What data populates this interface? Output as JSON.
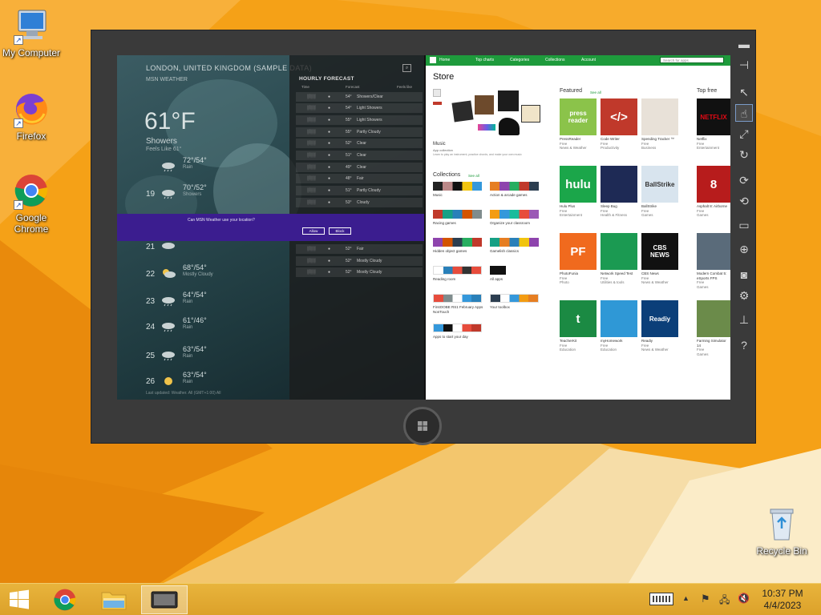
{
  "desktop": {
    "icons": [
      {
        "label": "My Computer",
        "icon": "computer-icon"
      },
      {
        "label": "Firefox",
        "icon": "firefox-icon"
      },
      {
        "label": "Google\nChrome",
        "icon": "chrome-icon"
      },
      {
        "label": "Recycle Bin",
        "icon": "recycle-bin-icon"
      }
    ]
  },
  "weather": {
    "location": "LONDON, UNITED KINGDOM (SAMPLE DATA)",
    "provider": "MSN WEATHER",
    "temp": "61°F",
    "condition": "Showers",
    "feels_like": "Feels Like 61°",
    "days": [
      {
        "day": "",
        "hi_lo": "72°/54°",
        "desc": "Rain"
      },
      {
        "day": "19",
        "hi_lo": "70°/52°",
        "desc": "Showers"
      },
      {
        "day": "",
        "hi_lo": "",
        "desc": ""
      },
      {
        "day": "21",
        "hi_lo": "",
        "desc": ""
      },
      {
        "day": "22",
        "hi_lo": "68°/54°",
        "desc": "Mostly Cloudy"
      },
      {
        "day": "23",
        "hi_lo": "64°/54°",
        "desc": "Rain"
      },
      {
        "day": "24",
        "hi_lo": "61°/46°",
        "desc": "Rain"
      },
      {
        "day": "25",
        "hi_lo": "63°/54°",
        "desc": "Rain"
      },
      {
        "day": "26",
        "hi_lo": "63°/54°",
        "desc": "Rain"
      }
    ],
    "hourly_title": "HOURLY FORECAST",
    "hourly_headers": [
      "Time",
      "",
      "Forecast",
      "Feels like",
      ""
    ],
    "hourly_rows": [
      {
        "temp": "54°",
        "desc": "Showers/Clear"
      },
      {
        "temp": "54°",
        "desc": "Light Showers"
      },
      {
        "temp": "55°",
        "desc": "Light Showers"
      },
      {
        "temp": "55°",
        "desc": "Partly Cloudy"
      },
      {
        "temp": "52°",
        "desc": "Clear"
      },
      {
        "temp": "51°",
        "desc": "Clear"
      },
      {
        "temp": "49°",
        "desc": "Clear"
      },
      {
        "temp": "48°",
        "desc": "Fair"
      },
      {
        "temp": "51°",
        "desc": "Partly Cloudy"
      },
      {
        "temp": "53°",
        "desc": "Cloudy"
      },
      {
        "temp": "",
        "desc": ""
      },
      {
        "temp": "",
        "desc": ""
      },
      {
        "temp": "52°",
        "desc": "Fair"
      },
      {
        "temp": "52°",
        "desc": "Mostly Cloudy"
      },
      {
        "temp": "52°",
        "desc": "Mostly Cloudy"
      }
    ],
    "footer": "Last updated: Weather. All (GMT+1:00) All"
  },
  "location_dialog": {
    "message": "Can MSN Weather use your location?",
    "allow": "Allow",
    "block": "Block"
  },
  "store": {
    "nav": [
      "Home",
      "Top charts",
      "Categories",
      "Collections",
      "Account"
    ],
    "search_placeholder": "Search for apps",
    "title": "Store",
    "music_label": "Music",
    "music_sub": "App collection",
    "music_desc": "Learn to play an instrument, practice chords, and make your own music",
    "collections_label": "Collections",
    "see_all": "See all",
    "featured_label": "Featured",
    "top_free_label": "Top free",
    "collections": [
      "Music",
      "Action & arcade games",
      "Racing games",
      "Organize your classroom",
      "Hidden object games",
      "Gamelish classics",
      "Reading room",
      "All apps",
      "FirstOOBE RS1 February Apps NonTouch",
      "Your toolbox",
      "Apps to start your day",
      ""
    ],
    "featured": [
      {
        "name": "PressReader",
        "price": "Free",
        "cat": "News & Weather",
        "art": "press\nreader"
      },
      {
        "name": "Code Writer",
        "price": "Free",
        "cat": "Productivity",
        "art": "</>"
      },
      {
        "name": "Spending Tracker ™",
        "price": "Free",
        "cat": "Business",
        "art": ""
      },
      {
        "name": "Hulu Plus",
        "price": "Free",
        "cat": "Entertainment",
        "art": "hulu"
      },
      {
        "name": "Sleep Bug",
        "price": "Free",
        "cat": "Health & Fitness",
        "art": ""
      },
      {
        "name": "BallStrike",
        "price": "Free",
        "cat": "Games",
        "art": "BallStrike"
      },
      {
        "name": "PhotoFunia",
        "price": "Free",
        "cat": "Photo",
        "art": "PF"
      },
      {
        "name": "Network Speed Test",
        "price": "Free",
        "cat": "Utilities & tools",
        "art": ""
      },
      {
        "name": "CBS News",
        "price": "Free",
        "cat": "News & Weather",
        "art": "CBS\nNEWS"
      },
      {
        "name": "TeacherKit",
        "price": "Free",
        "cat": "Education",
        "art": "t"
      },
      {
        "name": "myHomework",
        "price": "Free",
        "cat": "Education",
        "art": ""
      },
      {
        "name": "Readiy",
        "price": "Free",
        "cat": "News & Weather",
        "art": "Readiy"
      }
    ],
    "top_free": [
      {
        "name": "Netflix",
        "price": "Free",
        "cat": "Entertainment",
        "art": "NETFLIX"
      },
      {
        "name": "Asphalt 8: Airborne",
        "price": "Free",
        "cat": "Games",
        "art": "8"
      },
      {
        "name": "Modern Combat 5: eSports FPS",
        "price": "Free",
        "cat": "Games",
        "art": ""
      },
      {
        "name": "Farming Simulator 14",
        "price": "Free",
        "cat": "Games",
        "art": ""
      }
    ]
  },
  "simulator_toolbar": [
    "minimize-icon",
    "pin-icon",
    "pointer-icon",
    "touch-icon",
    "pinch-zoom-icon",
    "rotate-touch-icon",
    "rotate-clockwise-icon",
    "rotate-counterclockwise-icon",
    "resolution-icon",
    "location-icon",
    "screenshot-icon",
    "settings-icon",
    "network-icon",
    "help-icon"
  ],
  "taskbar": {
    "time": "10:37 PM",
    "date": "4/4/2023"
  },
  "colors": {
    "wallpaper": "#f6a11a",
    "store_green": "#1e9b3c",
    "dialog_purple": "#3b1d8f",
    "taskbar": "#dca12a"
  }
}
